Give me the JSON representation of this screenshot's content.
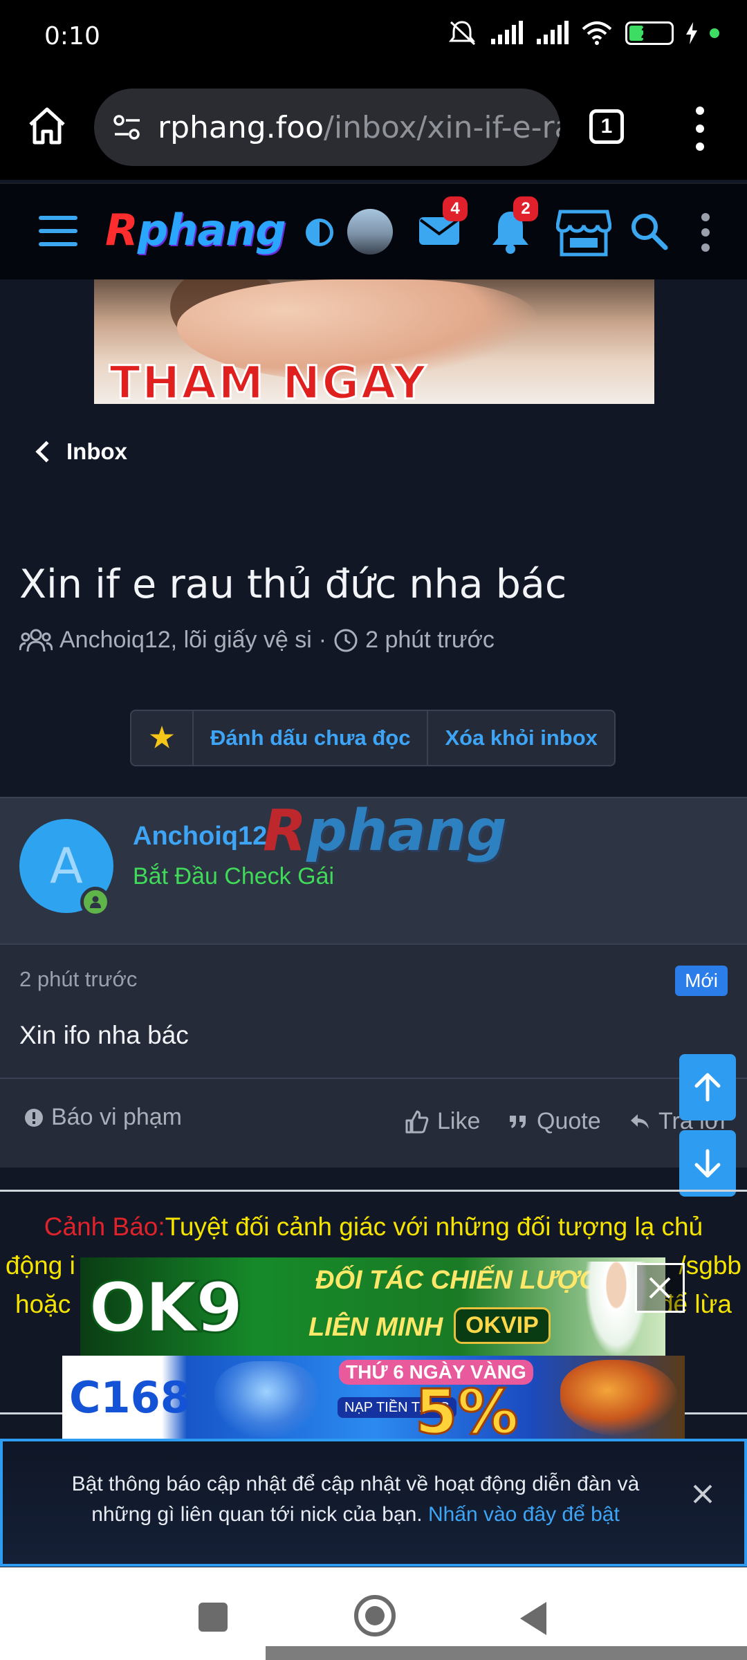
{
  "status_bar": {
    "time": "0:10",
    "battery": "26",
    "icons": [
      "mute-icon",
      "signal-icon",
      "signal-icon",
      "wifi-icon",
      "battery-icon",
      "charging-icon"
    ]
  },
  "browser": {
    "url_host": "rphang.foo",
    "url_path": "/inbox/xin-if-e-ra",
    "tab_count": "1"
  },
  "site_header": {
    "logo_r": "R",
    "logo_rest": "phang",
    "messages_badge": "4",
    "alerts_badge": "2"
  },
  "top_ad": {
    "text": "THAM NGAY"
  },
  "breadcrumb": {
    "label": "Inbox"
  },
  "conversation": {
    "title": "Xin if e rau thủ đức nha bác",
    "participants": "Anchoiq12, lõi giấy vệ si",
    "separator": "·",
    "time": "2 phút trước",
    "actions": {
      "star": "★",
      "mark_unread": "Đánh dấu chưa đọc",
      "remove": "Xóa khỏi inbox"
    }
  },
  "message": {
    "avatar_letter": "A",
    "username": "Anchoiq12",
    "watermark_r": "R",
    "watermark_rest": "phang",
    "user_title": "Bắt Đầu Check Gái",
    "time": "2 phút trước",
    "new_badge": "Mới",
    "text": "Xin ifo nha bác",
    "report": "Báo vi phạm",
    "like": "Like",
    "quote": "Quote",
    "reply": "Trả lời"
  },
  "warning": {
    "label": "Cảnh Báo:",
    "text_line1": "Tuyệt đối cảnh giác với những đối tượng lạ chủ",
    "text_line2": "động i",
    "text_line2_end": "/sgbb",
    "text_line3": "hoặc",
    "text_line3_end": "để lừa"
  },
  "ads": {
    "ok9_logo": "OK9",
    "ok9_line1": "ĐỐI TÁC CHIẾN LƯỢC",
    "ok9_line2": "LIÊN MINH",
    "ok9_badge": "OKVIP",
    "c168_logo": "C168",
    "c168_tag": "THỨ 6 NGÀY VÀNG",
    "c168_deposit": "NẠP TIỀN TẶNG",
    "c168_pct": "5%"
  },
  "notification": {
    "text": "Bật thông báo cập nhật để cập nhật về hoạt động diễn đàn và những gì liên quan tới nick của bạn.",
    "link": "Nhấn vào đây để bật"
  },
  "colors": {
    "accent": "#3ea4f5",
    "background": "#121726",
    "warning_label": "#e0232a",
    "warning_text": "#f5e400",
    "online": "#5fb44a",
    "user_title": "#41d95a"
  }
}
